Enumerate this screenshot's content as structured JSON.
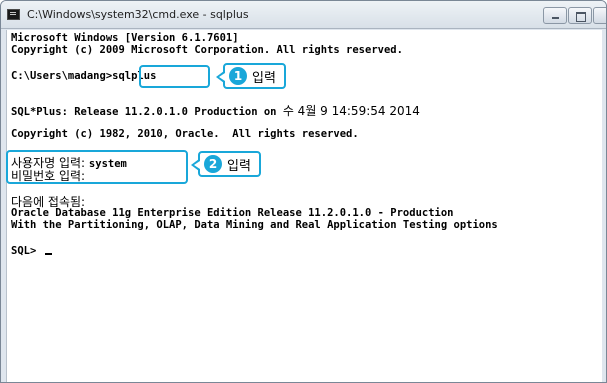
{
  "window": {
    "title": "C:\\Windows\\system32\\cmd.exe - sqlplus"
  },
  "console": {
    "lines": [
      "Microsoft Windows [Version 6.1.7601]",
      "Copyright (c) 2009 Microsoft Corporation. All rights reserved.",
      "",
      "C:\\Users\\madang>",
      "sqlplus",
      "",
      "SQL*Plus: Release 11.2.0.1.0 Production on ",
      "수 4월 9 14:59:54 2014",
      "Copyright (c) 1982, 2010, Oracle.  All rights reserved.",
      "사용자명 입력: ",
      "system",
      "비밀번호 입력:",
      "다음에 접속됨:",
      "Oracle Database 11g Enterprise Edition Release 11.2.0.1.0 - Production",
      "With the Partitioning, OLAP, Data Mining and Real Application Testing options",
      "SQL> "
    ]
  },
  "callouts": [
    {
      "number": "1",
      "label": "입력"
    },
    {
      "number": "2",
      "label": "입력"
    }
  ],
  "colors": {
    "accent": "#19a7d9"
  },
  "icons": {
    "app": "cmd-icon",
    "minimize": "minimize-icon",
    "maximize": "maximize-icon",
    "close": "close-icon"
  }
}
